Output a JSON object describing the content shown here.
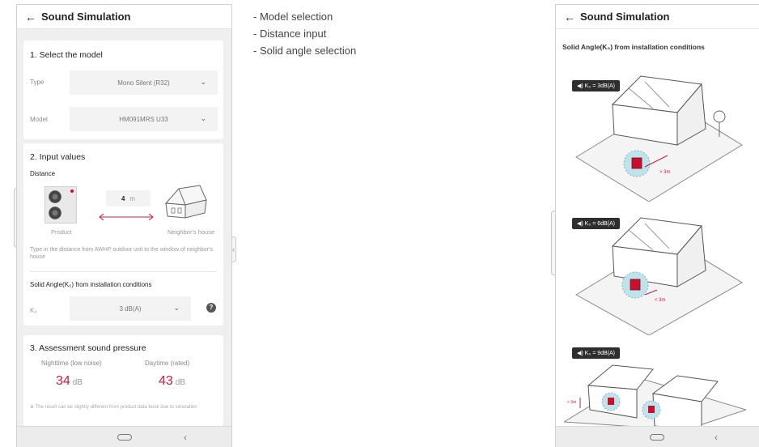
{
  "left_phone": {
    "header": {
      "title": "Sound Simulation"
    },
    "section1": {
      "title": "1. Select the model",
      "type_label": "Type",
      "type_value": "Mono Silent (R32)",
      "model_label": "Model",
      "model_value": "HM091MRS U33"
    },
    "section2": {
      "title": "2. Input values",
      "distance_label": "Distance",
      "distance_value": "4",
      "distance_unit": "m",
      "product_caption": "Product",
      "neighbor_caption": "Neighbor's house",
      "help_text": "Type in the distance from AWHP outdoor unit to the window of neighbor's house",
      "solid_angle_title": "Solid Angle(K₀) from installation conditions",
      "ko_label": "K₀",
      "ko_value": "3 dB(A)",
      "help_icon": "?"
    },
    "section3": {
      "title": "3. Assessment sound pressure",
      "nighttime_label": "Nighttime (low noise)",
      "nighttime_value": "34",
      "daytime_label": "Daytime (rated)",
      "daytime_value": "43",
      "unit": "dB",
      "note": "※ The result can be slightly different from product data book due to simulation"
    }
  },
  "features": [
    "- Model selection",
    "- Distance input",
    "- Solid angle selection"
  ],
  "right_phone": {
    "header": {
      "title": "Sound Simulation"
    },
    "subtitle": "Solid Angle(K₀) from installation conditions",
    "scenes": [
      {
        "badge": "K₀ = 3dB(A)",
        "distance": "> 3m"
      },
      {
        "badge": "K₀ = 6dB(A)",
        "distance": "< 3m"
      },
      {
        "badge": "K₀ = 9dB(A)",
        "distance": "< 3m"
      }
    ]
  },
  "icons": {
    "back": "arrow-left",
    "chevron": "chevron-down",
    "help": "question-circle",
    "home": "home-pill",
    "nav_back": "chevron-left",
    "speaker": "speaker"
  },
  "colors": {
    "accent_red": "#d3183a",
    "badge_bg": "#2e2e2e",
    "highlight_circle": "#bfe3ea"
  }
}
